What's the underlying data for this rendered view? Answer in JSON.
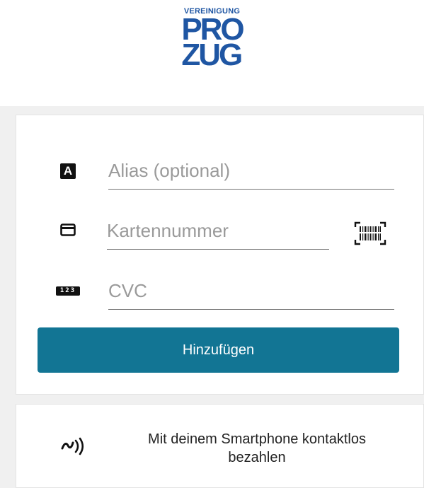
{
  "logo": {
    "top_text": "VEREINIGUNG",
    "line1": "PRO",
    "line2": "ZUG",
    "color": "#1f56a3"
  },
  "form": {
    "alias": {
      "placeholder": "Alias (optional)",
      "value": "",
      "icon": "alias-letter-icon"
    },
    "card_number": {
      "placeholder": "Kartennummer",
      "value": "",
      "icon": "credit-card-icon",
      "scan_icon": "barcode-scan-icon"
    },
    "cvc": {
      "placeholder": "CVC",
      "value": "",
      "icon": "numeric-123-icon"
    },
    "alias_icon_letter": "A",
    "cvc_icon_text": "123",
    "submit_label": "Hinzufügen"
  },
  "nfc": {
    "icon": "contactless-icon",
    "text": "Mit deinem Smartphone kontaktlos\nbezahlen"
  },
  "colors": {
    "accent": "#127594",
    "background": "#f0f0f0"
  }
}
